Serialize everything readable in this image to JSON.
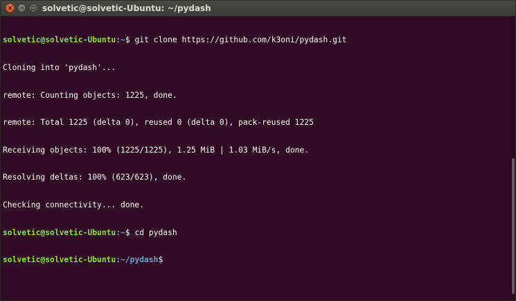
{
  "window": {
    "title": "solvetic@solvetic-Ubuntu: ~/pydash",
    "controls": {
      "close_icon": "close-icon",
      "minimize_icon": "minimize-icon",
      "maximize_icon": "maximize-icon"
    }
  },
  "terminal": {
    "background": "#300a24",
    "prompt_color": "#8ae234",
    "path_color": "#729fcf",
    "text_color": "#ffffff",
    "lines": [
      {
        "user": "solvetic@solvetic-Ubuntu",
        "sep": ":",
        "path": "~",
        "suffix": "$ git clone https://github.com/k3oni/pydash.git"
      },
      {
        "text": "Cloning into 'pydash'..."
      },
      {
        "text": "remote: Counting objects: 1225, done."
      },
      {
        "text": "remote: Total 1225 (delta 0), reused 0 (delta 0), pack-reused 1225"
      },
      {
        "text": "Receiving objects: 100% (1225/1225), 1.25 MiB | 1.03 MiB/s, done."
      },
      {
        "text": "Resolving deltas: 100% (623/623), done."
      },
      {
        "text": "Checking connectivity... done."
      },
      {
        "user": "solvetic@solvetic-Ubuntu",
        "sep": ":",
        "path": "~",
        "suffix": "$ cd pydash"
      },
      {
        "user": "solvetic@solvetic-Ubuntu",
        "sep": ":",
        "path": "~/pydash",
        "suffix": "$"
      }
    ]
  }
}
